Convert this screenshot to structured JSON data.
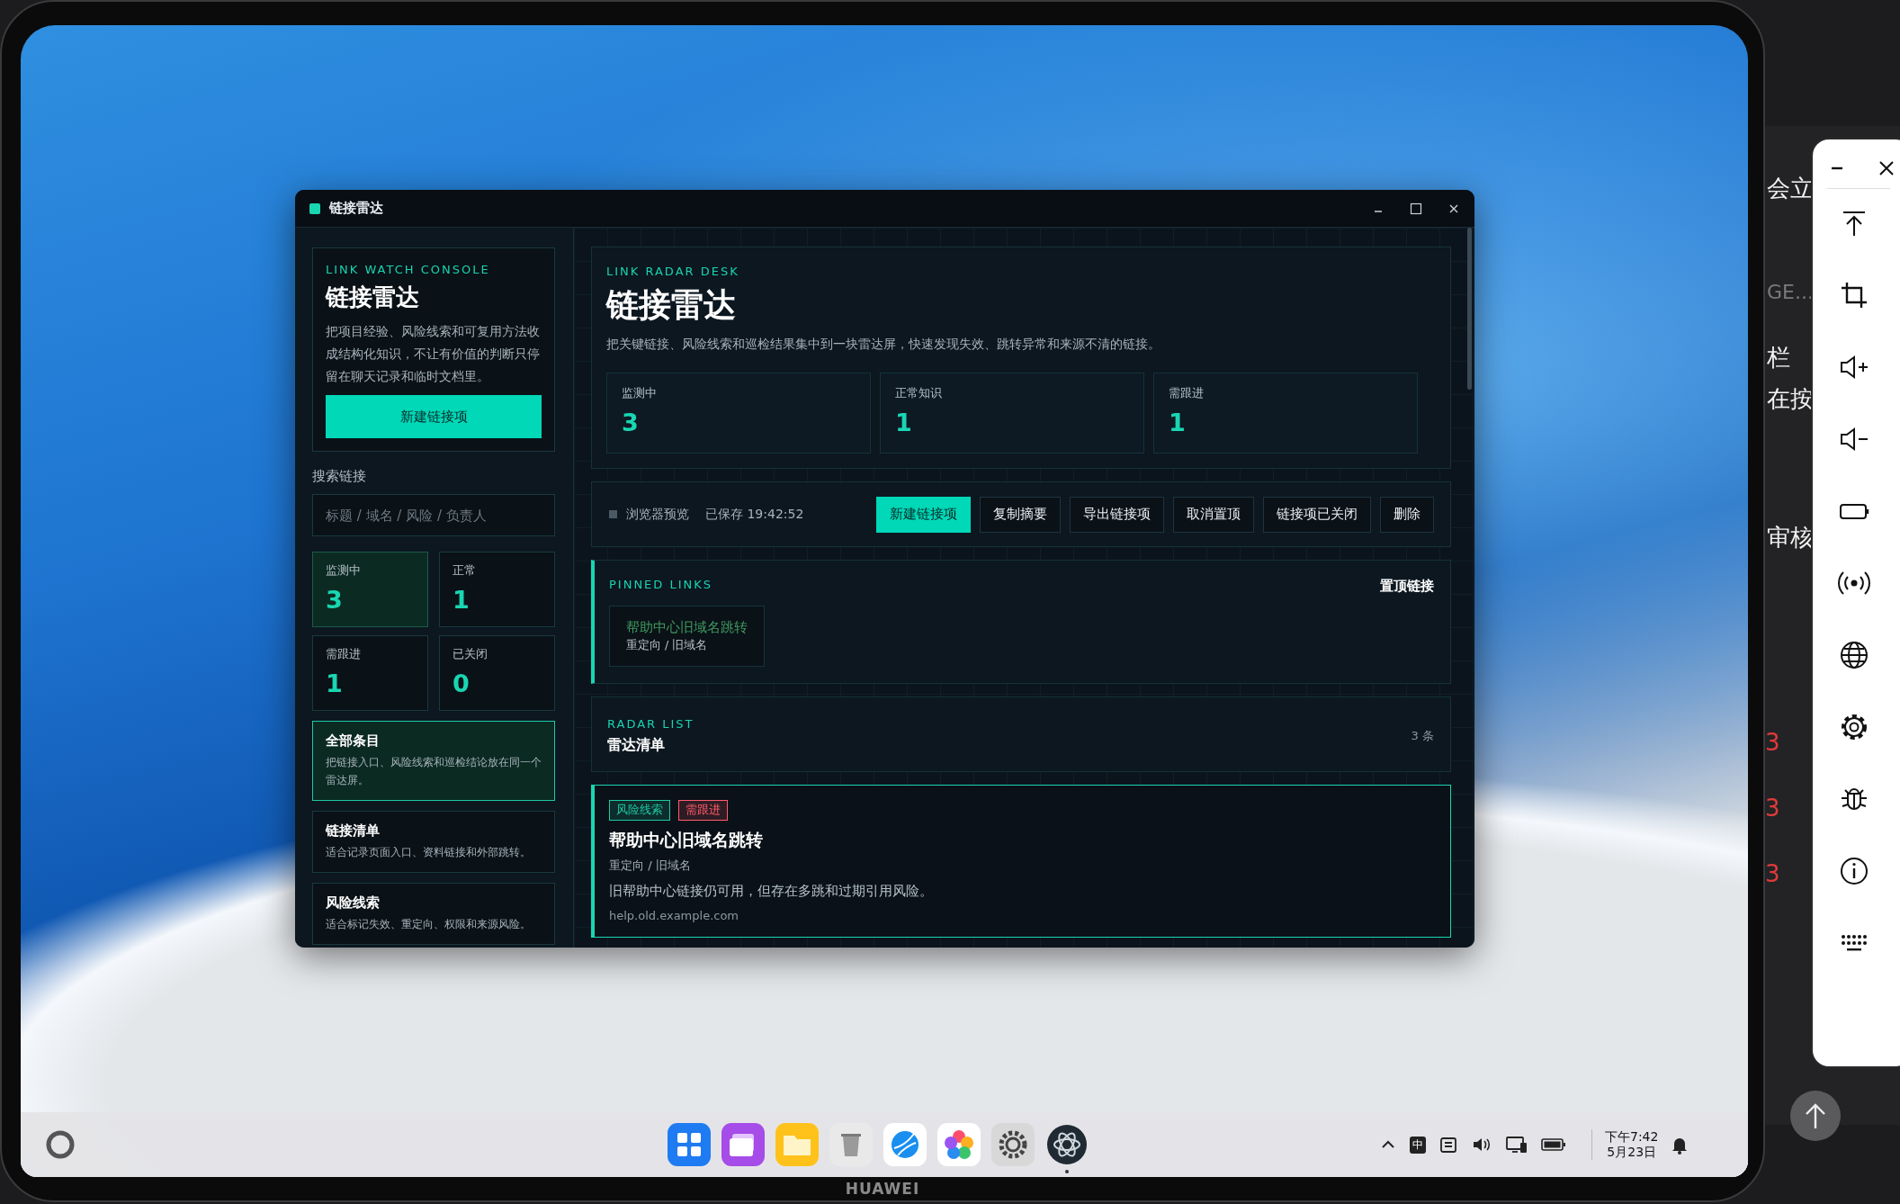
{
  "window": {
    "title": "链接雷达"
  },
  "sidebar": {
    "eyebrow": "LINK WATCH CONSOLE",
    "title": "链接雷达",
    "description": "把项目经验、风险线索和可复用方法收成结构化知识，不让有价值的判断只停留在聊天记录和临时文档里。",
    "create_button": "新建链接项",
    "search": {
      "label": "搜索链接",
      "placeholder": "标题 / 域名 / 风险 / 负责人"
    },
    "stats": [
      {
        "label": "监测中",
        "value": "3",
        "selected": true
      },
      {
        "label": "正常",
        "value": "1",
        "selected": false
      },
      {
        "label": "需跟进",
        "value": "1",
        "selected": false
      },
      {
        "label": "已关闭",
        "value": "0",
        "selected": false
      }
    ],
    "views": [
      {
        "title": "全部条目",
        "description": "把链接入口、风险线索和巡检结论放在同一个雷达屏。",
        "selected": true
      },
      {
        "title": "链接清单",
        "description": "适合记录页面入口、资料链接和外部跳转。",
        "selected": false
      },
      {
        "title": "风险线索",
        "description": "适合标记失效、重定向、权限和来源风险。",
        "selected": false
      }
    ]
  },
  "main": {
    "hero": {
      "eyebrow": "LINK RADAR DESK",
      "title": "链接雷达",
      "description": "把关键链接、风险线索和巡检结果集中到一块雷达屏，快速发现失效、跳转异常和来源不清的链接。",
      "stats": [
        {
          "label": "监测中",
          "value": "3"
        },
        {
          "label": "正常知识",
          "value": "1"
        },
        {
          "label": "需跟进",
          "value": "1"
        }
      ]
    },
    "toolbar": {
      "mode": "浏览器预览",
      "saved": "已保存 19:42:52",
      "buttons": [
        {
          "label": "新建链接项",
          "kind": "primary"
        },
        {
          "label": "复制摘要",
          "kind": "secondary"
        },
        {
          "label": "导出链接项",
          "kind": "secondary"
        },
        {
          "label": "取消置顶",
          "kind": "secondary"
        },
        {
          "label": "链接项已关闭",
          "kind": "secondary"
        },
        {
          "label": "删除",
          "kind": "secondary"
        }
      ]
    },
    "pinned": {
      "eyebrow": "PINNED LINKS",
      "title": "置顶链接",
      "items": [
        {
          "title": "帮助中心旧域名跳转",
          "subtitle": "重定向 / 旧域名"
        }
      ]
    },
    "radar_list": {
      "eyebrow": "RADAR LIST",
      "title": "雷达清单",
      "count": "3 条",
      "items": [
        {
          "selected": true,
          "tags": [
            {
              "label": "风险线索",
              "color": "#1fc9a4"
            },
            {
              "label": "需跟进",
              "color": "#ff5c6c"
            }
          ],
          "title": "帮助中心旧域名跳转",
          "subtitle": "重定向 / 旧域名",
          "description": "旧帮助中心链接仍可用，但存在多跳和过期引用风险。",
          "url": "help.old.example.com"
        }
      ]
    }
  },
  "taskbar": {
    "apps": [
      {
        "running": false
      },
      {
        "running": false
      },
      {
        "running": false
      },
      {
        "running": false
      },
      {
        "running": false
      },
      {
        "running": false
      },
      {
        "running": false
      },
      {
        "running": true
      }
    ],
    "tray": {
      "input_method": "中",
      "time": "下午7:42",
      "date": "5月23日"
    }
  },
  "device": {
    "brand": "HUAWEI"
  },
  "background_window": {
    "texts": [
      "会立",
      "GE...",
      "栏",
      "在按",
      "审核"
    ],
    "rows": [
      {
        "value": "3"
      },
      {
        "value": "3"
      },
      {
        "value": "3"
      }
    ]
  }
}
